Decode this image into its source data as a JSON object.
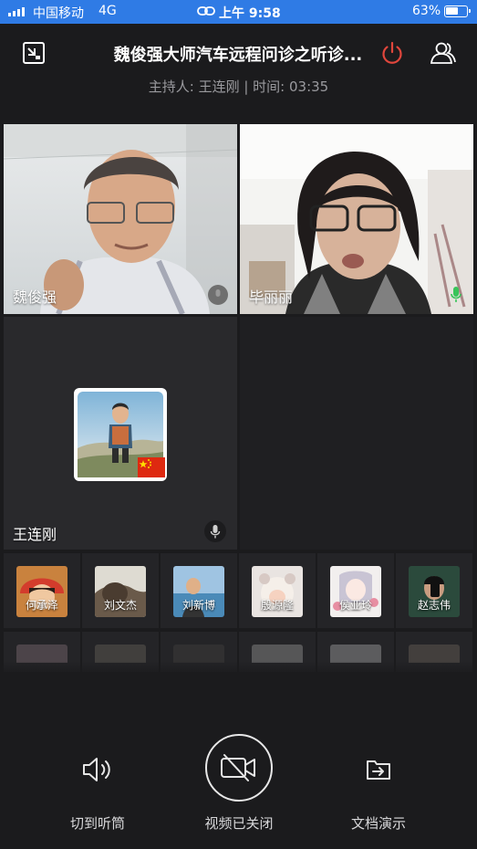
{
  "status_bar": {
    "carrier": "中国移动",
    "network": "4G",
    "time": "上午 9:58",
    "battery": "63%",
    "battery_level": 0.63
  },
  "header": {
    "title": "魏俊强大师汽车远程问诊之听诊...",
    "subtitle": "主持人: 王连刚 | 时间: 03:35"
  },
  "colors": {
    "status_bar": "#2f7be5",
    "background": "#1b1b1d",
    "hangup_red": "#e0463c",
    "mic_green": "#39c45a"
  },
  "video_tiles": [
    {
      "name": "魏俊强",
      "mic": "mic-muted-icon"
    },
    {
      "name": "毕丽丽",
      "mic": "mic-active-icon"
    },
    {
      "name": "王连刚",
      "mic": "mic-icon",
      "avatar_flag": "china-flag-icon"
    }
  ],
  "participants": [
    {
      "name": "何承泽"
    },
    {
      "name": "刘文杰"
    },
    {
      "name": "刘新博"
    },
    {
      "name": "殷源隆"
    },
    {
      "name": "侯亚玲"
    },
    {
      "name": "赵志伟"
    }
  ],
  "controls": {
    "earpiece": "切到听筒",
    "video": "视频已关闭",
    "document": "文档演示"
  },
  "icons": {
    "minimize": "minimize-icon",
    "hangup": "power-icon",
    "participants": "participants-icon",
    "speaker": "speaker-icon",
    "video_off": "video-off-icon",
    "share_doc": "share-document-icon"
  }
}
